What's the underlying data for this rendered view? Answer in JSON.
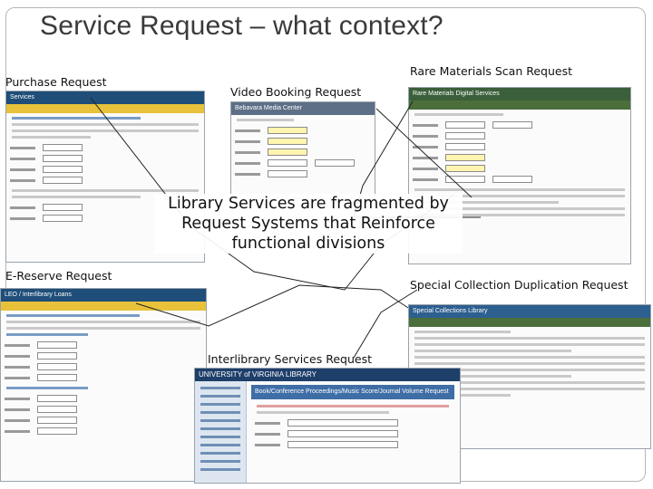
{
  "slide": {
    "title": "Service Request – what context?",
    "center_message": "Library Services are fragmented by Request Systems that Reinforce functional divisions"
  },
  "captions": {
    "purchase": "Purchase Request",
    "video": "Video Booking Request",
    "rare": "Rare Materials Scan Request",
    "ereserve": "E-Reserve Request",
    "special": "Special Collection Duplication Request",
    "ill": "Interlibrary Services Request"
  },
  "screenshots": {
    "purchase": {
      "brand": "Services"
    },
    "video": {
      "brand": "Bebavara Media Center"
    },
    "rare": {
      "brand": "Rare Materials Digital Services"
    },
    "ereserve": {
      "brand": "LEO / Interlibrary Loans"
    },
    "special": {
      "brand": "Special Collections Library"
    },
    "ill": {
      "brand": "UNIVERSITY of VIRGINIA LIBRARY",
      "tab_label": "Book/Conference Proceedings/Music Score/Journal Volume Request"
    }
  },
  "colors": {
    "title": "#3a3a3a",
    "uva_blue": "#1f4e79",
    "callout_line": "#222222"
  }
}
